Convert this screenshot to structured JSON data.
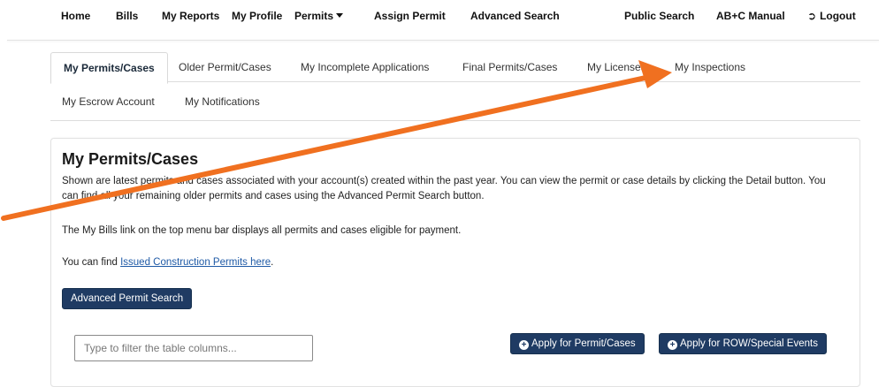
{
  "topnav": {
    "home": "Home",
    "bills": "Bills",
    "my_reports": "My Reports",
    "my_profile": "My Profile",
    "permits": "Permits",
    "assign_permit": "Assign Permit",
    "advanced_search": "Advanced Search",
    "public_search": "Public Search",
    "manual": "AB+C Manual",
    "logout": "Logout"
  },
  "tabs": {
    "my_permits": "My Permits/Cases",
    "older": "Older Permit/Cases",
    "incomplete": "My Incomplete Applications",
    "final": "Final Permits/Cases",
    "licenses": "My Licenses",
    "inspections": "My Inspections",
    "escrow": "My Escrow Account",
    "notifications": "My Notifications"
  },
  "panel": {
    "title": "My Permits/Cases",
    "para1": "Shown are latest permits and cases associated with your account(s) created within the past year. You can view the permit or case details by clicking the Detail button. You can find all your remaining older permits and cases using the Advanced Permit Search button.",
    "para2": "The My Bills link on the top menu bar displays all permits and cases eligible for payment.",
    "para3_prefix": "You can find ",
    "para3_link": "Issued Construction Permits here",
    "para3_suffix": ".",
    "advanced_button": "Advanced Permit Search",
    "filter_placeholder": "Type to filter the table columns...",
    "apply_permit_button": "Apply for Permit/Cases",
    "apply_row_button": "Apply for ROW/Special Events"
  },
  "colors": {
    "button_dark": "#1f3b63",
    "link": "#1f5aa6",
    "annotation_arrow": "#f07020"
  }
}
